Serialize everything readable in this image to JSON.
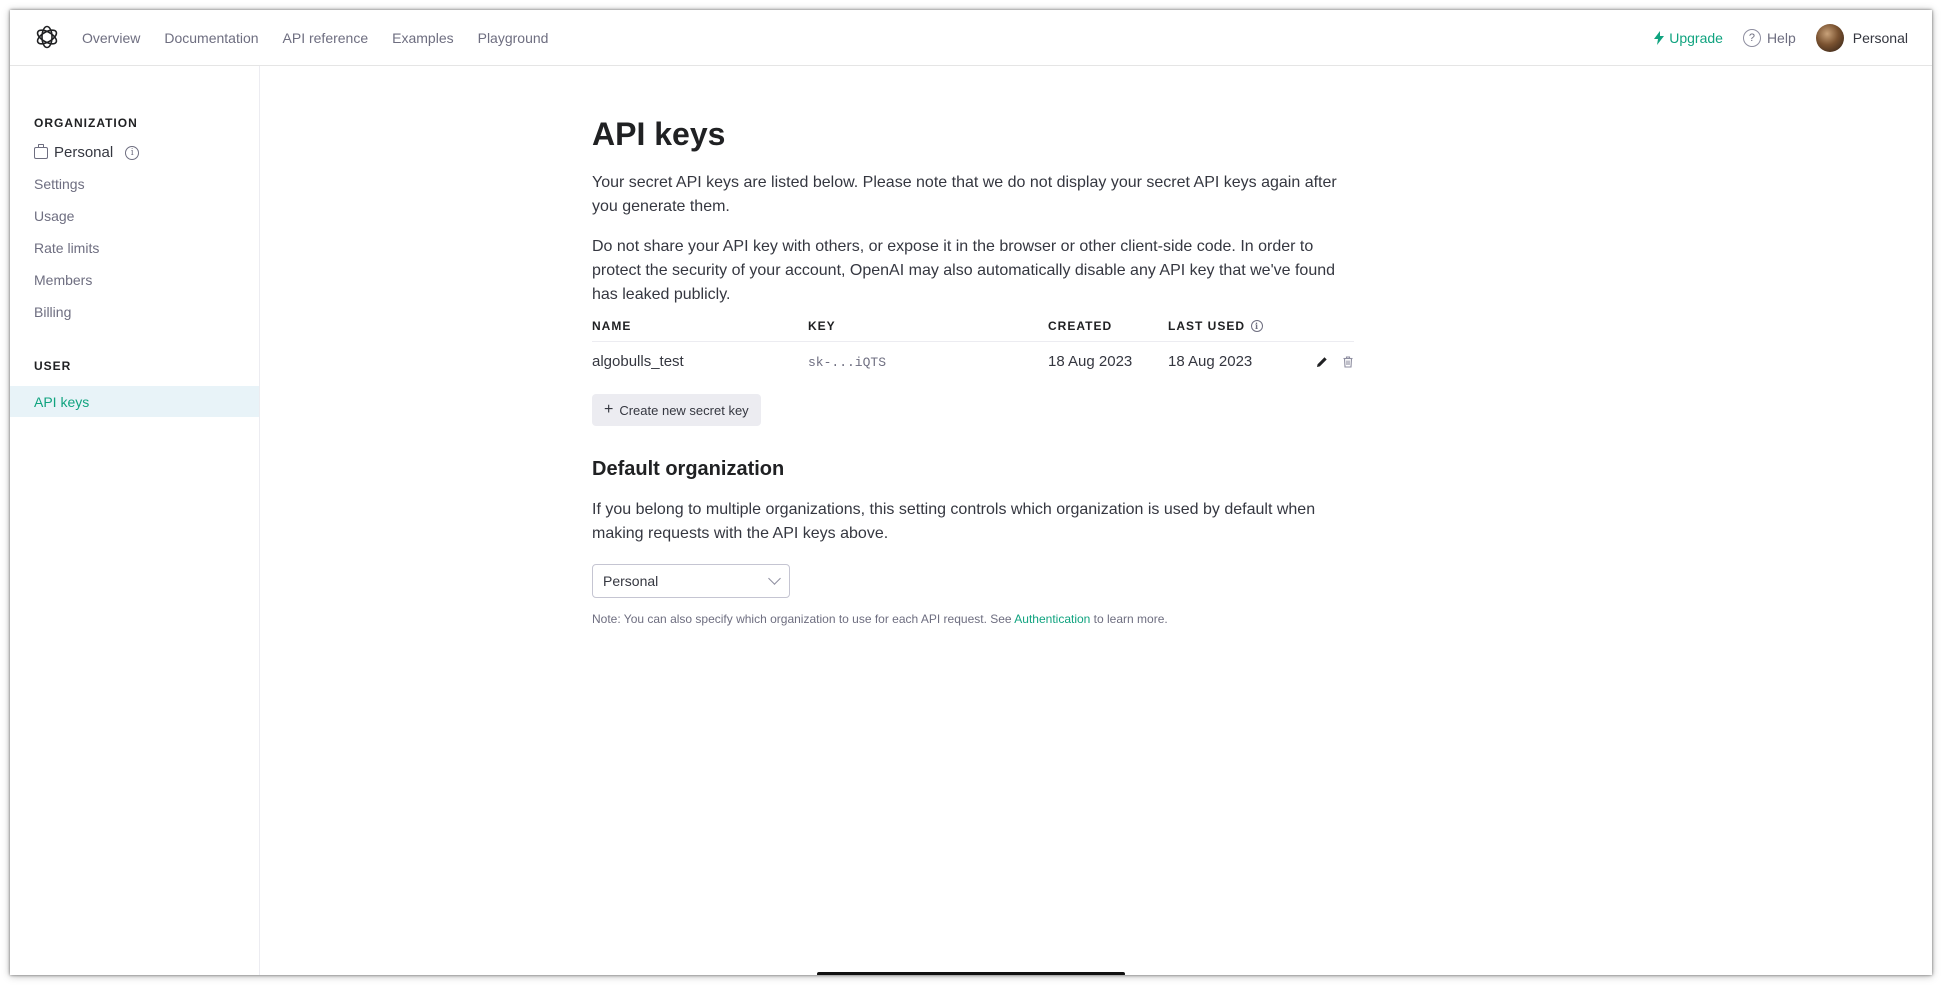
{
  "nav": {
    "links": [
      "Overview",
      "Documentation",
      "API reference",
      "Examples",
      "Playground"
    ],
    "upgrade_label": "Upgrade",
    "help_label": "Help",
    "profile_label": "Personal"
  },
  "sidebar": {
    "org_section_title": "ORGANIZATION",
    "org_name": "Personal",
    "org_items": [
      "Settings",
      "Usage",
      "Rate limits",
      "Members",
      "Billing"
    ],
    "user_section_title": "USER",
    "user_items": [
      "API keys"
    ]
  },
  "main": {
    "title": "API keys",
    "intro_1": "Your secret API keys are listed below. Please note that we do not display your secret API keys again after you generate them.",
    "intro_2": "Do not share your API key with others, or expose it in the browser or other client-side code. In order to protect the security of your account, OpenAI may also automatically disable any API key that we've found has leaked publicly.",
    "table": {
      "headers": [
        "NAME",
        "KEY",
        "CREATED",
        "LAST USED"
      ],
      "rows": [
        {
          "name": "algobulls_test",
          "key": "sk-...iQTS",
          "created": "18 Aug 2023",
          "last_used": "18 Aug 2023"
        }
      ]
    },
    "create_button_label": "Create new secret key",
    "default_org_title": "Default organization",
    "default_org_desc": "If you belong to multiple organizations, this setting controls which organization is used by default when making requests with the API keys above.",
    "default_org_value": "Personal",
    "note_prefix": "Note: You can also specify which organization to use for each API request. See ",
    "note_link": "Authentication",
    "note_suffix": " to learn more."
  },
  "colors": {
    "accent": "#10a37f",
    "active_bg": "#e8f3f8",
    "text_primary": "#202123",
    "text_secondary": "#6e6e80"
  }
}
